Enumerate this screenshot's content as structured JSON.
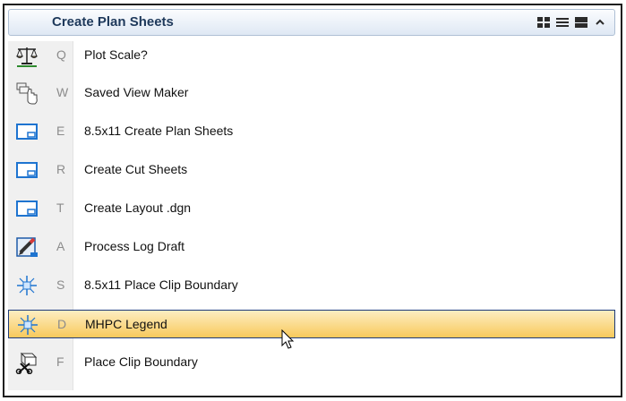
{
  "panel": {
    "title": "Create Plan Sheets",
    "toolbar": [
      {
        "name": "grid-view-icon"
      },
      {
        "name": "list-view-icon"
      },
      {
        "name": "detail-view-icon"
      },
      {
        "name": "collapse-chevron-icon"
      }
    ]
  },
  "items": [
    {
      "key": "Q",
      "label": "Plot Scale?",
      "icon": "scale-balance-icon"
    },
    {
      "key": "W",
      "label": "Saved View Maker",
      "icon": "hand-pointer-views-icon"
    },
    {
      "key": "E",
      "label": "8.5x11 Create  Plan Sheets",
      "icon": "sheet-layout-icon"
    },
    {
      "key": "R",
      "label": "Create Cut Sheets",
      "icon": "sheet-layout-icon"
    },
    {
      "key": "T",
      "label": "Create Layout .dgn",
      "icon": "sheet-layout-icon"
    },
    {
      "key": "A",
      "label": "Process Log Draft",
      "icon": "pencil-document-icon"
    },
    {
      "key": "S",
      "label": "8.5x11 Place Clip Boundary",
      "icon": "clip-sparkle-icon"
    },
    {
      "key": "D",
      "label": "MHPC Legend",
      "icon": "clip-sparkle-icon",
      "selected": true
    },
    {
      "key": "F",
      "label": "Place Clip Boundary",
      "icon": "cube-scissors-icon"
    }
  ],
  "colors": {
    "selected_top": "#fdeec2",
    "selected_bottom": "#f8c95c",
    "selected_border": "#1c3a7a",
    "header_text": "#1e395b",
    "key_text": "#8c8c8c"
  }
}
